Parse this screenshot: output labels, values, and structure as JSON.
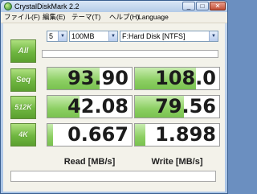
{
  "window": {
    "title": "CrystalDiskMark 2.2",
    "minimize_glyph": "_",
    "maximize_glyph": "□",
    "close_glyph": "✕"
  },
  "menu": {
    "items": [
      {
        "label": "ファイル(F)"
      },
      {
        "label": "編集(E)"
      },
      {
        "label": "テーマ(T)"
      },
      {
        "label": "ヘルプ(H)"
      },
      {
        "label": "Language"
      }
    ]
  },
  "controls": {
    "test_count": "5",
    "test_size": "100MB",
    "drive": "F:Hard Disk [NTFS]",
    "dropdown_glyph": "▼"
  },
  "buttons": {
    "all": "All",
    "seq": "Seq",
    "r512k": "512K",
    "r4k": "4K"
  },
  "results": {
    "seq": {
      "read": "93.90",
      "write": "108.0",
      "read_fill": 0.62,
      "write_fill": 0.72
    },
    "r512k": {
      "read": "42.08",
      "write": "79.56",
      "read_fill": 0.38,
      "write_fill": 0.58
    },
    "r4k": {
      "read": "0.667",
      "write": "1.898",
      "read_fill": 0.07,
      "write_fill": 0.12
    }
  },
  "labels": {
    "read": "Read [MB/s]",
    "write": "Write [MB/s]"
  },
  "colors": {
    "accent_green": "#6fb640",
    "bar_green": "#8ccf63"
  }
}
